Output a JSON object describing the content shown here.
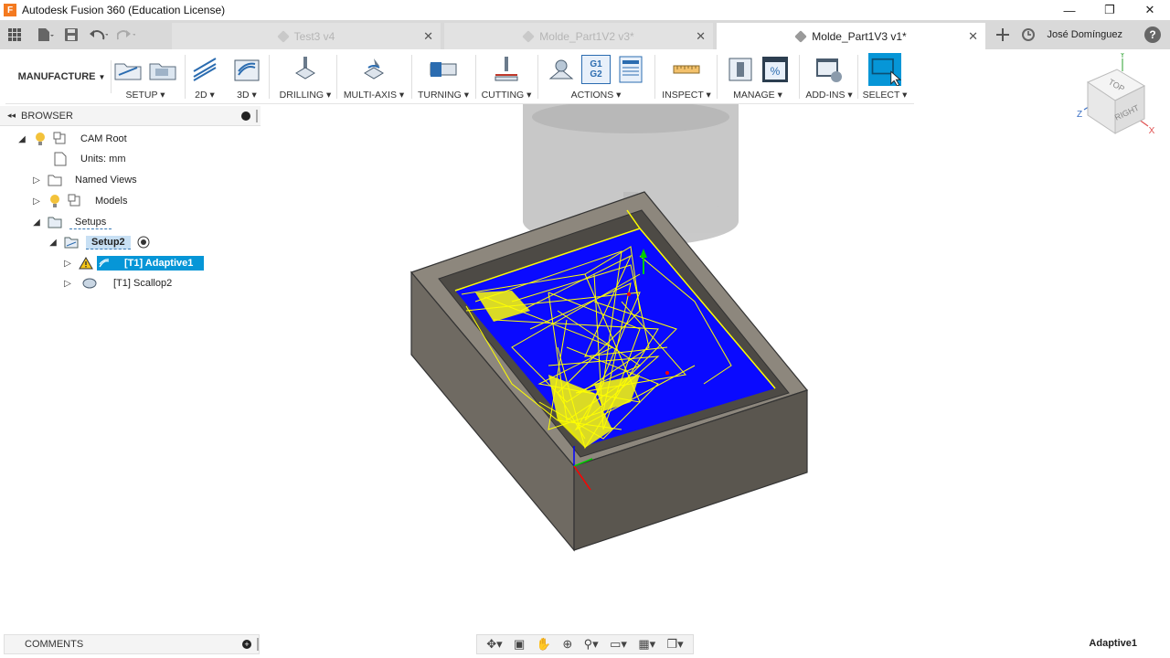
{
  "window": {
    "title": "Autodesk Fusion 360 (Education License)",
    "logo_letter": "F",
    "minimize": "—",
    "restore": "❐",
    "close": "✕"
  },
  "tabs": [
    {
      "label": "Test3 v4",
      "close": "✕"
    },
    {
      "label": "Molde_Part1V2 v3*",
      "close": "✕"
    },
    {
      "label": "Molde_Part1V3 v1*",
      "close": "✕"
    }
  ],
  "user": {
    "name": "José Domínguez",
    "help": "?"
  },
  "toolbar": {
    "workspace": "MANUFACTURE",
    "groups": [
      "SETUP",
      "2D",
      "3D",
      "DRILLING",
      "MULTI-AXIS",
      "TURNING",
      "CUTTING",
      "ACTIONS",
      "INSPECT",
      "MANAGE",
      "ADD-INS",
      "SELECT"
    ],
    "g1g2_top": "G1",
    "g1g2_bottom": "G2"
  },
  "browser": {
    "title": "BROWSER",
    "items": [
      {
        "label": "CAM Root"
      },
      {
        "label": "Units: mm"
      },
      {
        "label": "Named Views"
      },
      {
        "label": "Models"
      },
      {
        "label": "Setups"
      },
      {
        "label": "Setup2"
      },
      {
        "label": "[T1] Adaptive1"
      },
      {
        "label": "[T1] Scallop2"
      }
    ]
  },
  "viewcube": {
    "top": "TOP",
    "right": "RIGHT",
    "x": "X",
    "y": "Y",
    "z": "Z"
  },
  "comments": {
    "label": "COMMENTS"
  },
  "status": {
    "text": "Adaptive1"
  }
}
